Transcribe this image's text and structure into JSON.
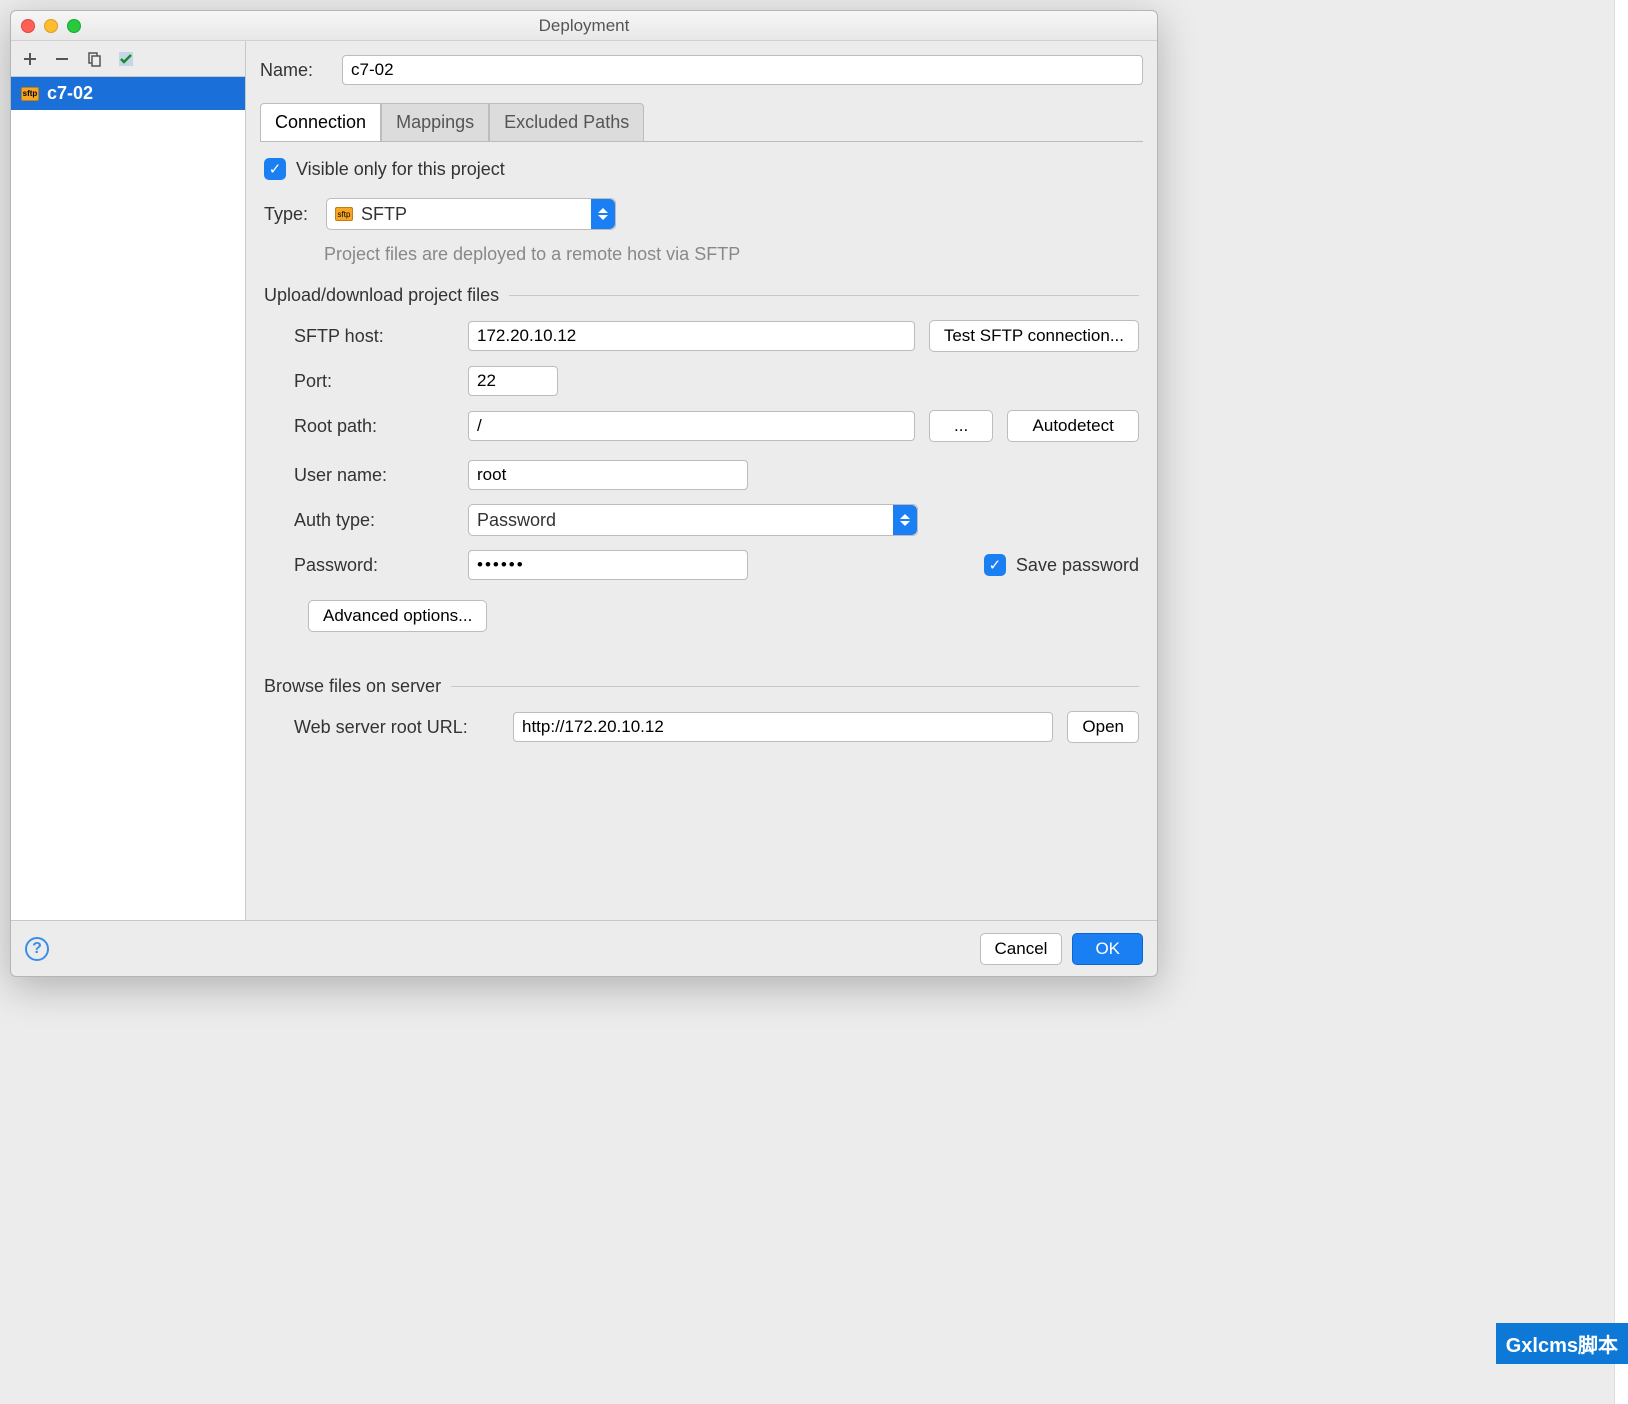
{
  "window": {
    "title": "Deployment"
  },
  "toolbar": {
    "add": "+",
    "remove": "−",
    "copy": "copy",
    "validate": "validate"
  },
  "servers": [
    {
      "name": "c7-02",
      "protocol": "sftp"
    }
  ],
  "form": {
    "name_label": "Name:",
    "name_value": "c7-02",
    "tabs": {
      "connection": "Connection",
      "mappings": "Mappings",
      "excluded": "Excluded Paths"
    },
    "visible_label": "Visible only for this project",
    "visible_checked": true,
    "type_label": "Type:",
    "type_value": "SFTP",
    "type_hint": "Project files are deployed to a remote host via SFTP",
    "section_upload": "Upload/download project files",
    "sftp_host_label": "SFTP host:",
    "sftp_host_value": "172.20.10.12",
    "test_button": "Test SFTP connection...",
    "port_label": "Port:",
    "port_value": "22",
    "root_path_label": "Root path:",
    "root_path_value": "/",
    "browse_button": "...",
    "autodetect_button": "Autodetect",
    "user_label": "User name:",
    "user_value": "root",
    "auth_label": "Auth type:",
    "auth_value": "Password",
    "password_label": "Password:",
    "password_value": "••••••",
    "save_password_label": "Save password",
    "save_password_checked": true,
    "advanced_button": "Advanced options...",
    "section_browse": "Browse files on server",
    "web_url_label": "Web server root URL:",
    "web_url_value": "http://172.20.10.12",
    "open_button": "Open"
  },
  "footer": {
    "help": "?",
    "cancel": "Cancel",
    "ok": "OK"
  },
  "watermark": "Gxlcms脚本"
}
